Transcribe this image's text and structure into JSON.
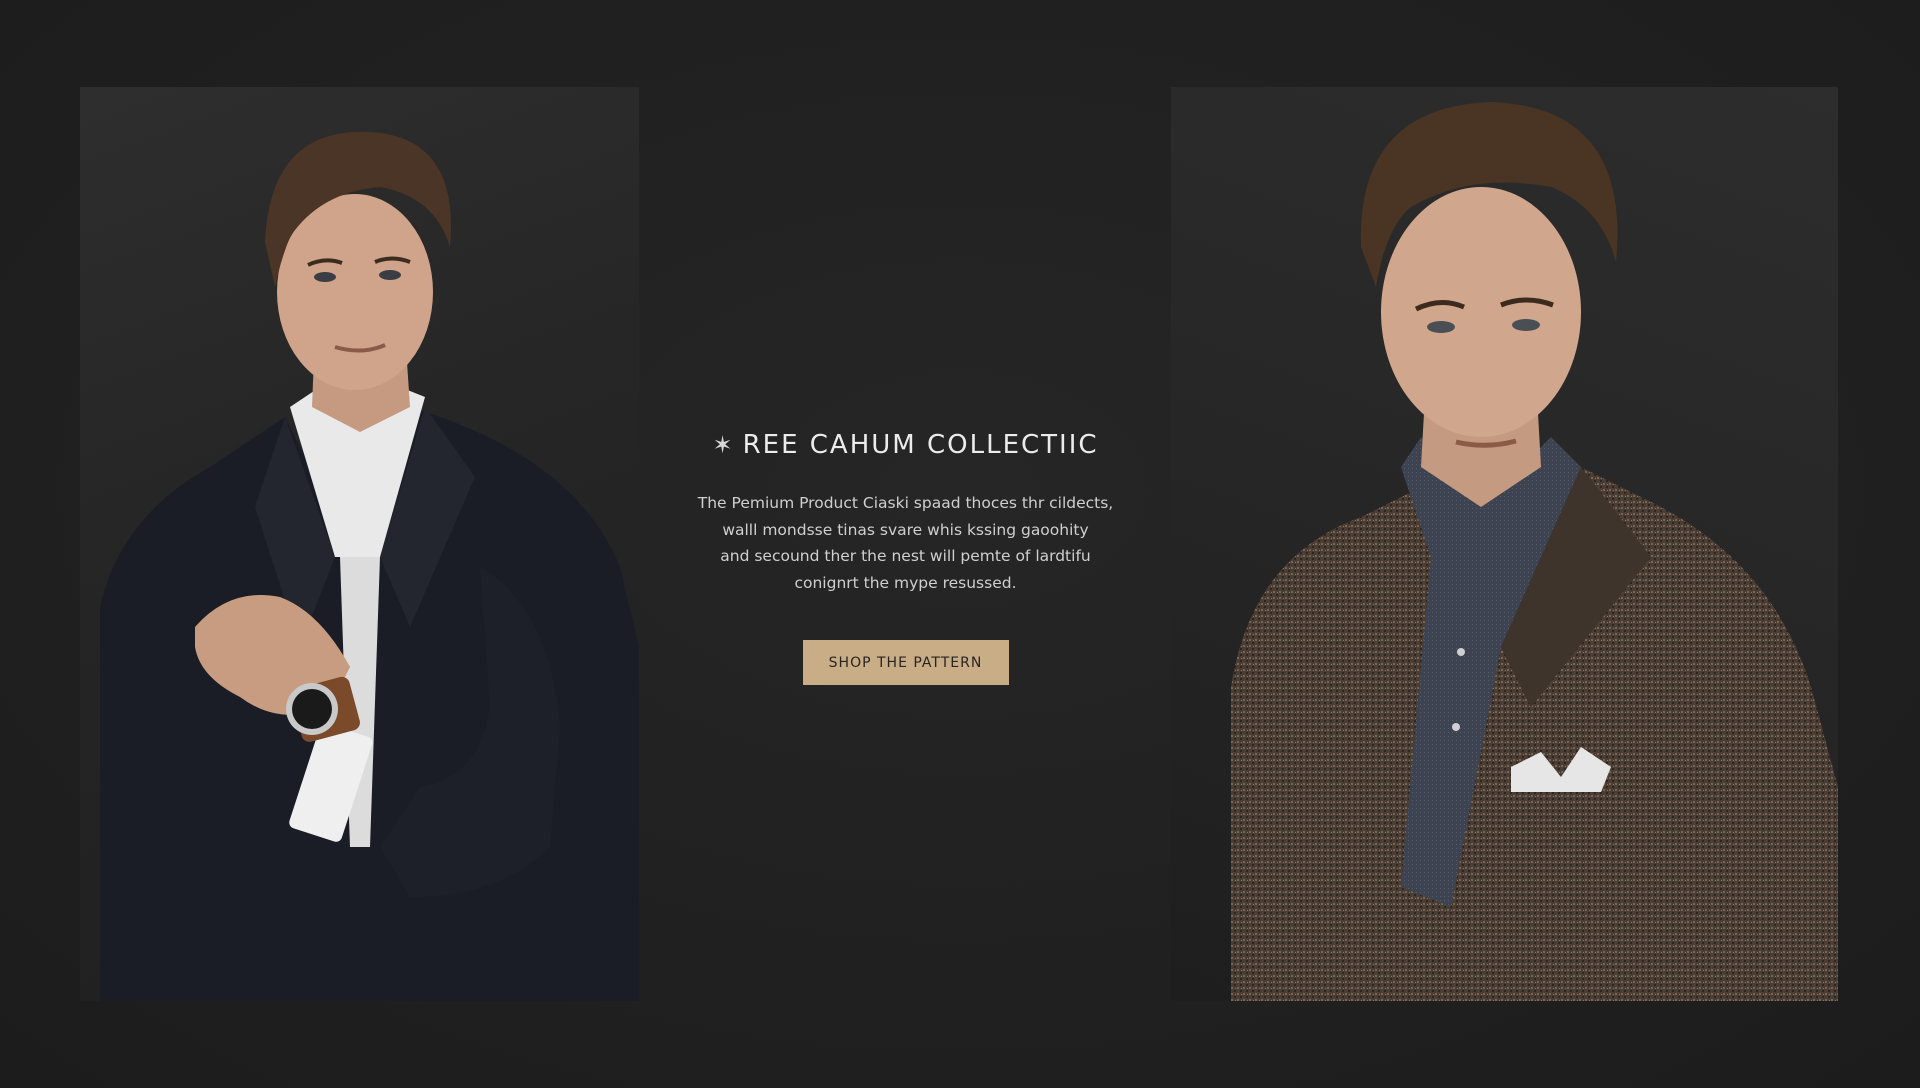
{
  "collection": {
    "heading": "REE CAHUM  COLLECTIIC",
    "star_icon": "✶",
    "description_lines": [
      "The Pemium Product Ciaski spaad thoces thr cildects,",
      "walll mondsse tinas svare whis kssing gaoohity",
      "and secound ther the nest will pemte of lardtifu",
      "conignrt the mype resussed."
    ],
    "cta_label": "SHOP THE PATTERN"
  },
  "colors": {
    "background": "#212121",
    "accent": "#c8ad86",
    "text": "#e6e6e6"
  },
  "images": {
    "left": "model-navy-suit-watch-photo",
    "right": "model-tweed-blazer-pocket-square-photo"
  }
}
